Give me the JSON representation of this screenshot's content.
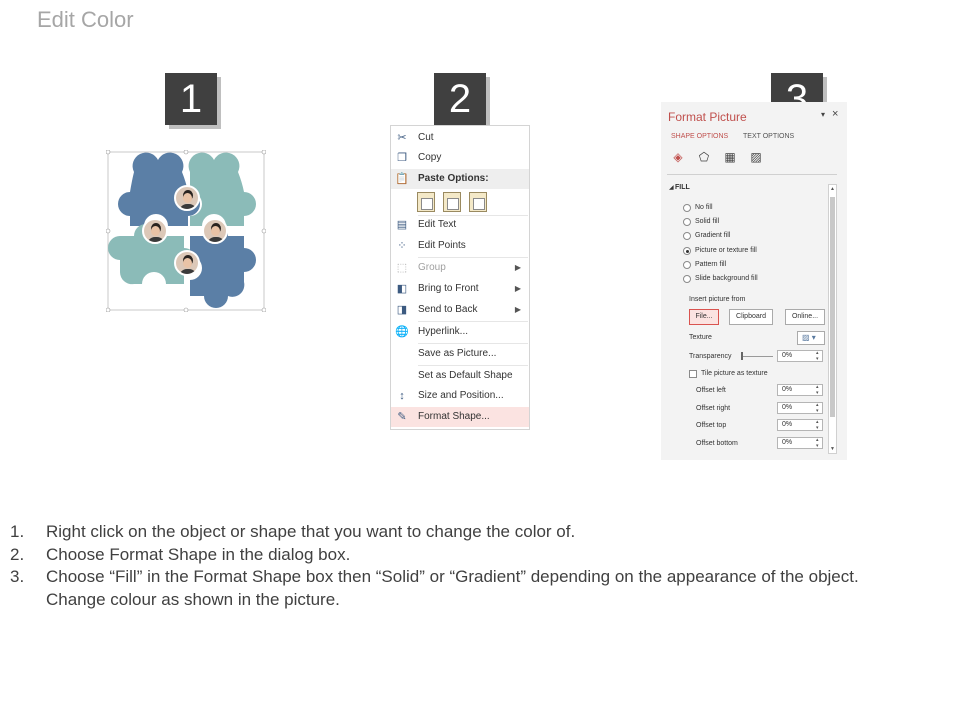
{
  "title": "Edit Color",
  "steps_badges": [
    "1",
    "2",
    "3"
  ],
  "colors": {
    "badge_bg": "#404040",
    "puzzle_blue": "#5b7fa6",
    "puzzle_teal": "#8bbbb8",
    "accent_red": "#c0504d",
    "hover_pink": "#fbe3e1"
  },
  "context_menu": {
    "items": [
      {
        "icon": "cut-icon",
        "label": "Cut"
      },
      {
        "icon": "copy-icon",
        "label": "Copy"
      },
      {
        "icon": "paste-icon",
        "label": "Paste Options:"
      },
      {
        "icon": "edit-text-icon",
        "label": "Edit Text"
      },
      {
        "icon": "edit-points-icon",
        "label": "Edit Points"
      },
      {
        "icon": "group-icon",
        "label": "Group"
      },
      {
        "icon": "bring-to-front-icon",
        "label": "Bring to Front"
      },
      {
        "icon": "send-to-back-icon",
        "label": "Send to Back"
      },
      {
        "icon": "hyperlink-icon",
        "label": "Hyperlink..."
      },
      {
        "icon": "",
        "label": "Save as Picture..."
      },
      {
        "icon": "",
        "label": "Set as Default Shape"
      },
      {
        "icon": "size-position-icon",
        "label": "Size and Position..."
      },
      {
        "icon": "format-shape-icon",
        "label": "Format Shape..."
      }
    ]
  },
  "format_pane": {
    "title": "Format Picture",
    "tabs": [
      "SHAPE OPTIONS",
      "TEXT OPTIONS"
    ],
    "icons": [
      "fill-bucket-icon",
      "pentagon-icon",
      "size-icon",
      "picture-icon"
    ],
    "section": "FILL",
    "fill_options": [
      {
        "label": "No fill",
        "selected": false
      },
      {
        "label": "Solid fill",
        "selected": false
      },
      {
        "label": "Gradient fill",
        "selected": false
      },
      {
        "label": "Picture or texture fill",
        "selected": true
      },
      {
        "label": "Pattern fill",
        "selected": false
      },
      {
        "label": "Slide background fill",
        "selected": false
      }
    ],
    "insert_picture_from": "Insert picture from",
    "buttons": [
      "File...",
      "Clipboard",
      "Online..."
    ],
    "texture_label": "Texture",
    "transparency_label": "Transparency",
    "transparency_value": "0%",
    "tile_label": "Tile picture as texture",
    "offsets": [
      {
        "label": "Offset left",
        "value": "0%"
      },
      {
        "label": "Offset right",
        "value": "0%"
      },
      {
        "label": "Offset top",
        "value": "0%"
      },
      {
        "label": "Offset bottom",
        "value": "0%"
      }
    ]
  },
  "instructions": [
    {
      "num": "1.",
      "text": "Right click on the object or shape that you want to change the color of."
    },
    {
      "num": "2.",
      "text": "Choose Format Shape in the dialog box."
    },
    {
      "num": "3.",
      "text": "Choose “Fill” in the Format Shape box then “Solid” or “Gradient” depending on the appearance of the object."
    },
    {
      "num": "",
      "text": "Change colour as shown in the picture."
    }
  ]
}
